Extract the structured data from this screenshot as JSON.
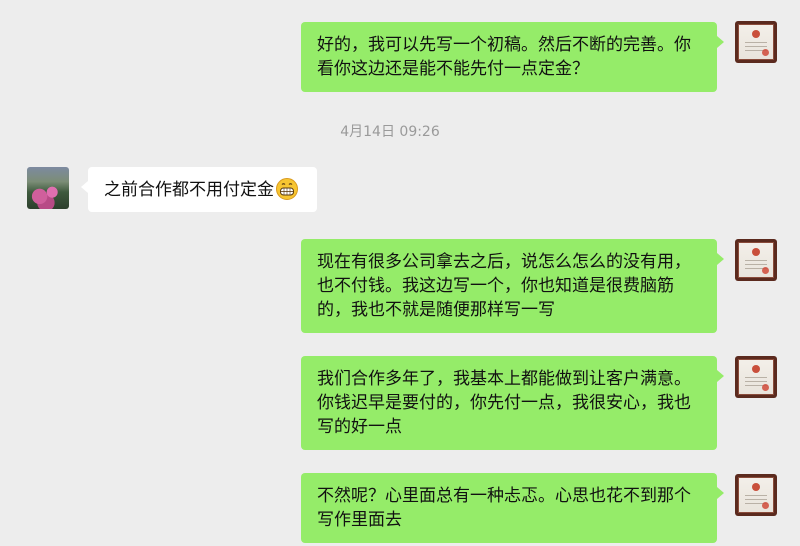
{
  "messages": [
    {
      "side": "me",
      "text": "好的，我可以先写一个初稿。然后不断的完善。你看你这边还是能不能先付一点定金？"
    },
    {
      "side": "system",
      "text": "4月14日 09:26"
    },
    {
      "side": "other",
      "text": "之前合作都不用付定金",
      "emoji": "grinning-face-icon"
    },
    {
      "side": "me",
      "text": "现在有很多公司拿去之后，说怎么怎么的没有用，也不付钱。我这边写一个，你也知道是很费脑筋的，我也不就是随便那样写一写"
    },
    {
      "side": "me",
      "text": "我们合作多年了，我基本上都能做到让客户满意。你钱迟早是要付的，你先付一点，我很安心，我也写的好一点"
    },
    {
      "side": "me",
      "text": "不然呢？心里面总有一种忐忑。心思也花不到那个写作里面去"
    }
  ],
  "colors": {
    "background": "#ededed",
    "my_bubble": "#95ec69",
    "their_bubble": "#ffffff",
    "timestamp_text": "#9a9a9a"
  }
}
